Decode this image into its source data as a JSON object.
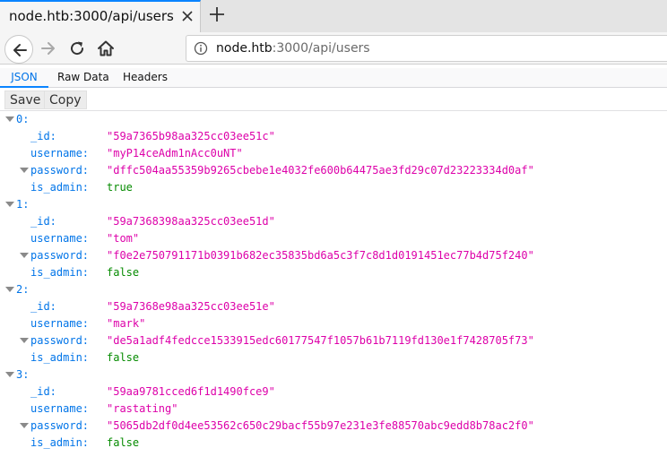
{
  "browser": {
    "tab_title": "node.htb:3000/api/users",
    "url_host": "node.htb",
    "url_rest": ":3000/api/users"
  },
  "viewer": {
    "tabs": [
      "JSON",
      "Raw Data",
      "Headers"
    ],
    "active_tab": "JSON",
    "save_label": "Save",
    "copy_label": "Copy"
  },
  "users": [
    {
      "index": "0:",
      "id_key": "_id:",
      "id_val": "\"59a7365b98aa325cc03ee51c\"",
      "username_key": "username:",
      "username_val": "\"myP14ceAdm1nAcc0uNT\"",
      "password_key": "password:",
      "password_val": "\"dffc504aa55359b9265cbebe1e4032fe600b64475ae3fd29c07d23223334d0af\"",
      "admin_key": "is_admin:",
      "admin_val": "true"
    },
    {
      "index": "1:",
      "id_key": "_id:",
      "id_val": "\"59a7368398aa325cc03ee51d\"",
      "username_key": "username:",
      "username_val": "\"tom\"",
      "password_key": "password:",
      "password_val": "\"f0e2e750791171b0391b682ec35835bd6a5c3f7c8d1d0191451ec77b4d75f240\"",
      "admin_key": "is_admin:",
      "admin_val": "false"
    },
    {
      "index": "2:",
      "id_key": "_id:",
      "id_val": "\"59a7368e98aa325cc03ee51e\"",
      "username_key": "username:",
      "username_val": "\"mark\"",
      "password_key": "password:",
      "password_val": "\"de5a1adf4fedcce1533915edc60177547f1057b61b7119fd130e1f7428705f73\"",
      "admin_key": "is_admin:",
      "admin_val": "false"
    },
    {
      "index": "3:",
      "id_key": "_id:",
      "id_val": "\"59aa9781cced6f1d1490fce9\"",
      "username_key": "username:",
      "username_val": "\"rastating\"",
      "password_key": "password:",
      "password_val": "\"5065db2df0d4ee53562c650c29bacf55b97e231e3fe88570abc9edd8b78ac2f0\"",
      "admin_key": "is_admin:",
      "admin_val": "false"
    }
  ],
  "colors": {
    "key": "#0074e8",
    "string": "#dd00a9",
    "boolean": "#058b00",
    "accent": "#0a84ff"
  },
  "icons": [
    "close-icon",
    "plus-icon",
    "back-arrow-icon",
    "forward-arrow-icon",
    "reload-icon",
    "home-icon",
    "info-icon",
    "twisty-icon"
  ]
}
